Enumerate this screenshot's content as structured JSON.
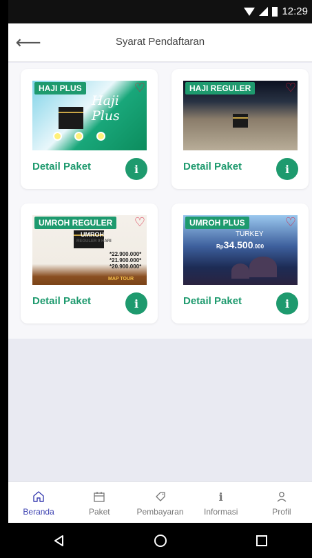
{
  "status_bar": {
    "time": "12:29"
  },
  "header": {
    "title": "Syarat Pendaftaran",
    "back_icon": "arrow-left-icon"
  },
  "packages": [
    {
      "tag": "HAJI PLUS",
      "detail_label": "Detail Paket",
      "thumb_text": "Haji Plus"
    },
    {
      "tag": "HAJI REGULER",
      "detail_label": "Detail Paket"
    },
    {
      "tag": "UMROH REGULER",
      "detail_label": "Detail Paket",
      "thumb_text": "UMROH",
      "thumb_subtext": "REGULER 9 HARI",
      "prices": [
        "*22.900.000*",
        "*21.900.000*",
        "*20.900.000*"
      ],
      "brand": "MAP TOUR"
    },
    {
      "tag": "UMROH PLUS",
      "detail_label": "Detail Paket",
      "thumb_text": "TURKEY",
      "thumb_price_prefix": "Rp",
      "thumb_price": "34.500",
      "thumb_price_suffix": ".000"
    }
  ],
  "bottom_nav": [
    {
      "label": "Beranda",
      "icon": "home-icon",
      "active": true
    },
    {
      "label": "Paket",
      "icon": "calendar-icon",
      "active": false
    },
    {
      "label": "Pembayaran",
      "icon": "tag-icon",
      "active": false
    },
    {
      "label": "Informasi",
      "icon": "info-icon",
      "active": false
    },
    {
      "label": "Profil",
      "icon": "user-icon",
      "active": false
    }
  ],
  "colors": {
    "accent": "#1e9a6e",
    "nav_active": "#3a3fb0",
    "heart": "#d61f3a"
  }
}
